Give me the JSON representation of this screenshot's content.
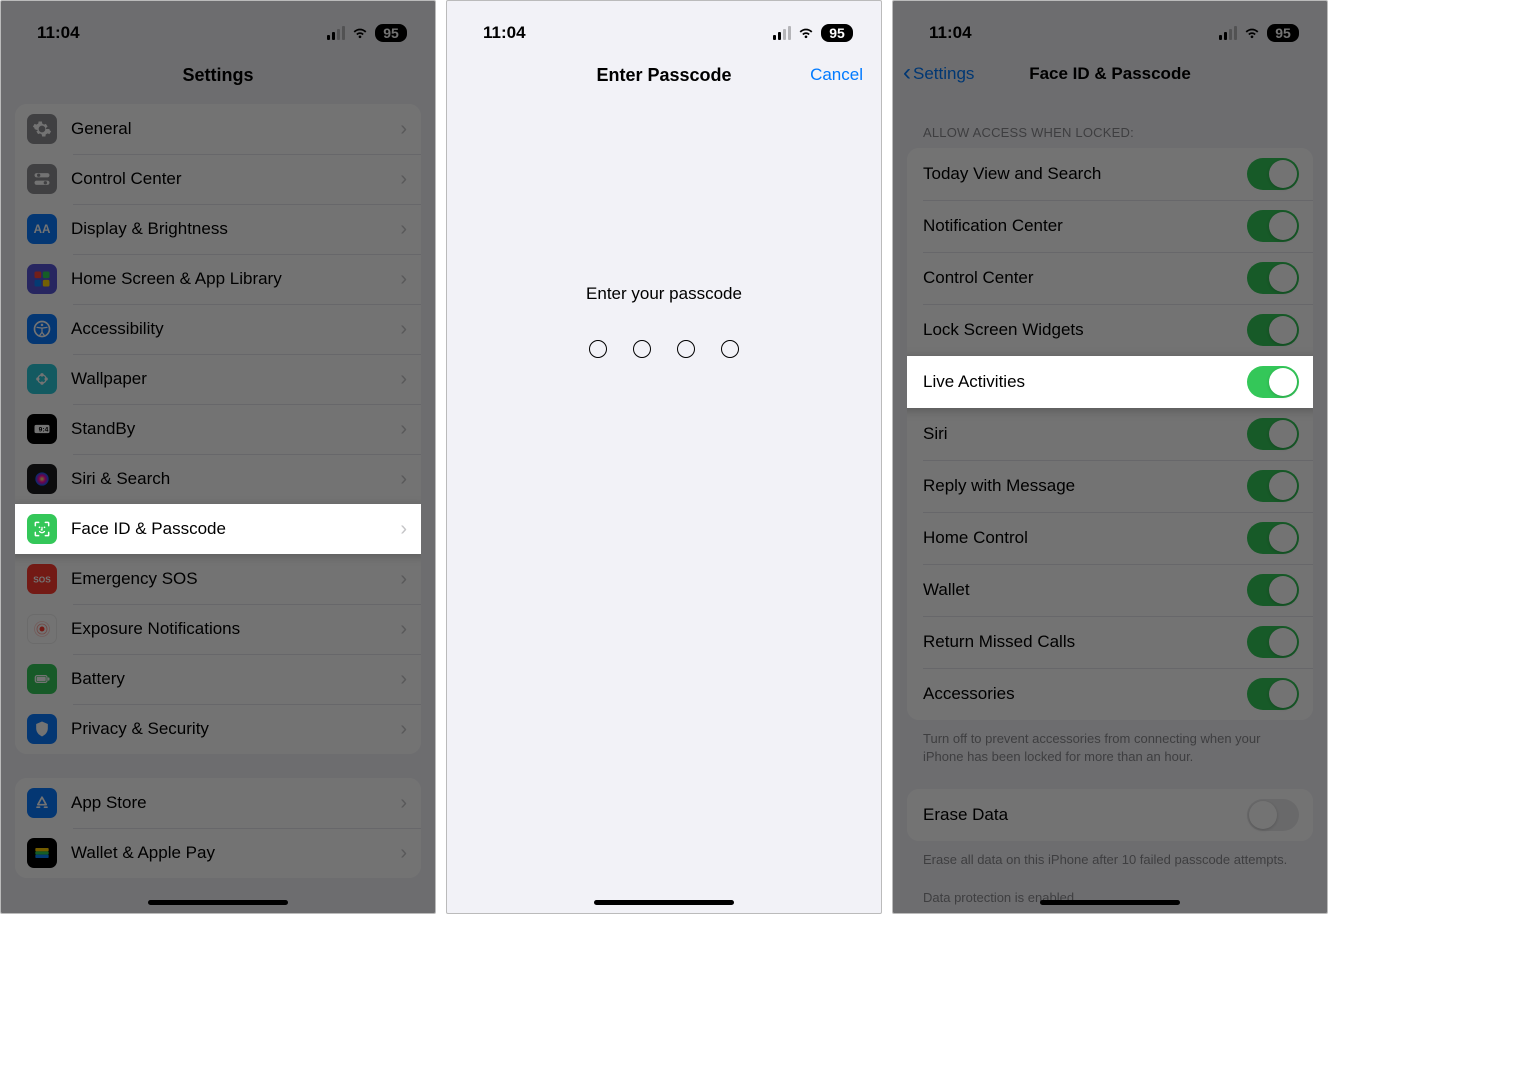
{
  "status": {
    "time": "11:04",
    "battery": "95"
  },
  "panel1": {
    "title": "Settings",
    "group1": [
      {
        "id": "general",
        "label": "General",
        "fg": "#fff"
      },
      {
        "id": "control-center",
        "label": "Control Center",
        "fg": "#fff"
      },
      {
        "id": "display",
        "label": "Display & Brightness",
        "fg": "#fff"
      },
      {
        "id": "home-screen",
        "label": "Home Screen & App Library",
        "fg": "#fff"
      },
      {
        "id": "accessibility",
        "label": "Accessibility",
        "fg": "#fff"
      },
      {
        "id": "wallpaper",
        "label": "Wallpaper",
        "fg": "#fff"
      },
      {
        "id": "standby",
        "label": "StandBy",
        "fg": "#fff"
      },
      {
        "id": "siri",
        "label": "Siri & Search",
        "fg": "#fff"
      },
      {
        "id": "faceid",
        "label": "Face ID & Passcode",
        "fg": "#fff",
        "highlight": true
      },
      {
        "id": "sos",
        "label": "Emergency SOS",
        "fg": "#fff"
      },
      {
        "id": "exposure",
        "label": "Exposure Notifications",
        "fg": "#ff3b30"
      },
      {
        "id": "battery",
        "label": "Battery",
        "fg": "#fff"
      },
      {
        "id": "privacy",
        "label": "Privacy & Security",
        "fg": "#fff"
      }
    ],
    "group2": [
      {
        "id": "appstore",
        "label": "App Store",
        "fg": "#fff"
      },
      {
        "id": "wallet",
        "label": "Wallet & Apple Pay",
        "fg": "#fff"
      }
    ]
  },
  "panel2": {
    "title": "Enter Passcode",
    "cancel": "Cancel",
    "prompt": "Enter your passcode",
    "digits": 4
  },
  "panel3": {
    "back": "Settings",
    "title": "Face ID & Passcode",
    "section_header": "ALLOW ACCESS WHEN LOCKED:",
    "toggles": [
      {
        "label": "Today View and Search",
        "on": true
      },
      {
        "label": "Notification Center",
        "on": true
      },
      {
        "label": "Control Center",
        "on": true
      },
      {
        "label": "Lock Screen Widgets",
        "on": true
      },
      {
        "label": "Live Activities",
        "on": true,
        "highlight": true
      },
      {
        "label": "Siri",
        "on": true
      },
      {
        "label": "Reply with Message",
        "on": true
      },
      {
        "label": "Home Control",
        "on": true
      },
      {
        "label": "Wallet",
        "on": true
      },
      {
        "label": "Return Missed Calls",
        "on": true
      },
      {
        "label": "Accessories",
        "on": true
      }
    ],
    "footer1": "Turn off to prevent accessories from connecting when your iPhone has been locked for more than an hour.",
    "erase": {
      "label": "Erase Data",
      "on": false
    },
    "footer2": "Erase all data on this iPhone after 10 failed passcode attempts.",
    "footer3": "Data protection is enabled."
  }
}
